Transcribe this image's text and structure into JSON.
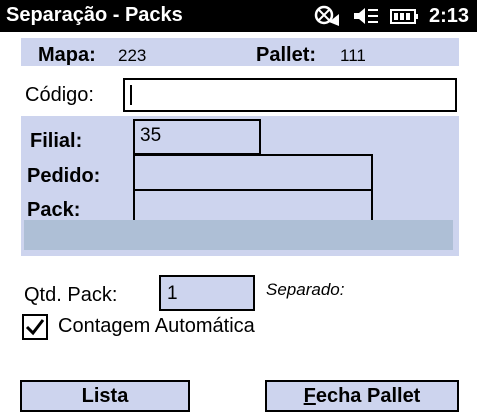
{
  "titlebar": {
    "title": "Separação - Packs",
    "time": "2:13",
    "icons": [
      "connectivity-icon",
      "volume-icon",
      "battery-icon"
    ]
  },
  "header": {
    "mapa_label": "Mapa:",
    "mapa_value": "223",
    "pallet_label": "Pallet:",
    "pallet_value": "111"
  },
  "codigo": {
    "label": "Código:",
    "value": ""
  },
  "details": {
    "filial_label": "Filial:",
    "filial_value": "35",
    "pedido_label": "Pedido:",
    "pedido_value": "",
    "pack_label": "Pack:",
    "pack_value": ""
  },
  "qtd": {
    "label": "Qtd. Pack:",
    "value": "1",
    "separado_label": "Separado:"
  },
  "contagem": {
    "label": "Contagem Automática",
    "checked": true
  },
  "buttons": {
    "lista_label": "Lista",
    "fecha_first": "F",
    "fecha_rest": "echa Pallet"
  },
  "colors": {
    "panel": "#cdd4ee",
    "strip": "#aebfd6",
    "titlebar": "#000000"
  }
}
